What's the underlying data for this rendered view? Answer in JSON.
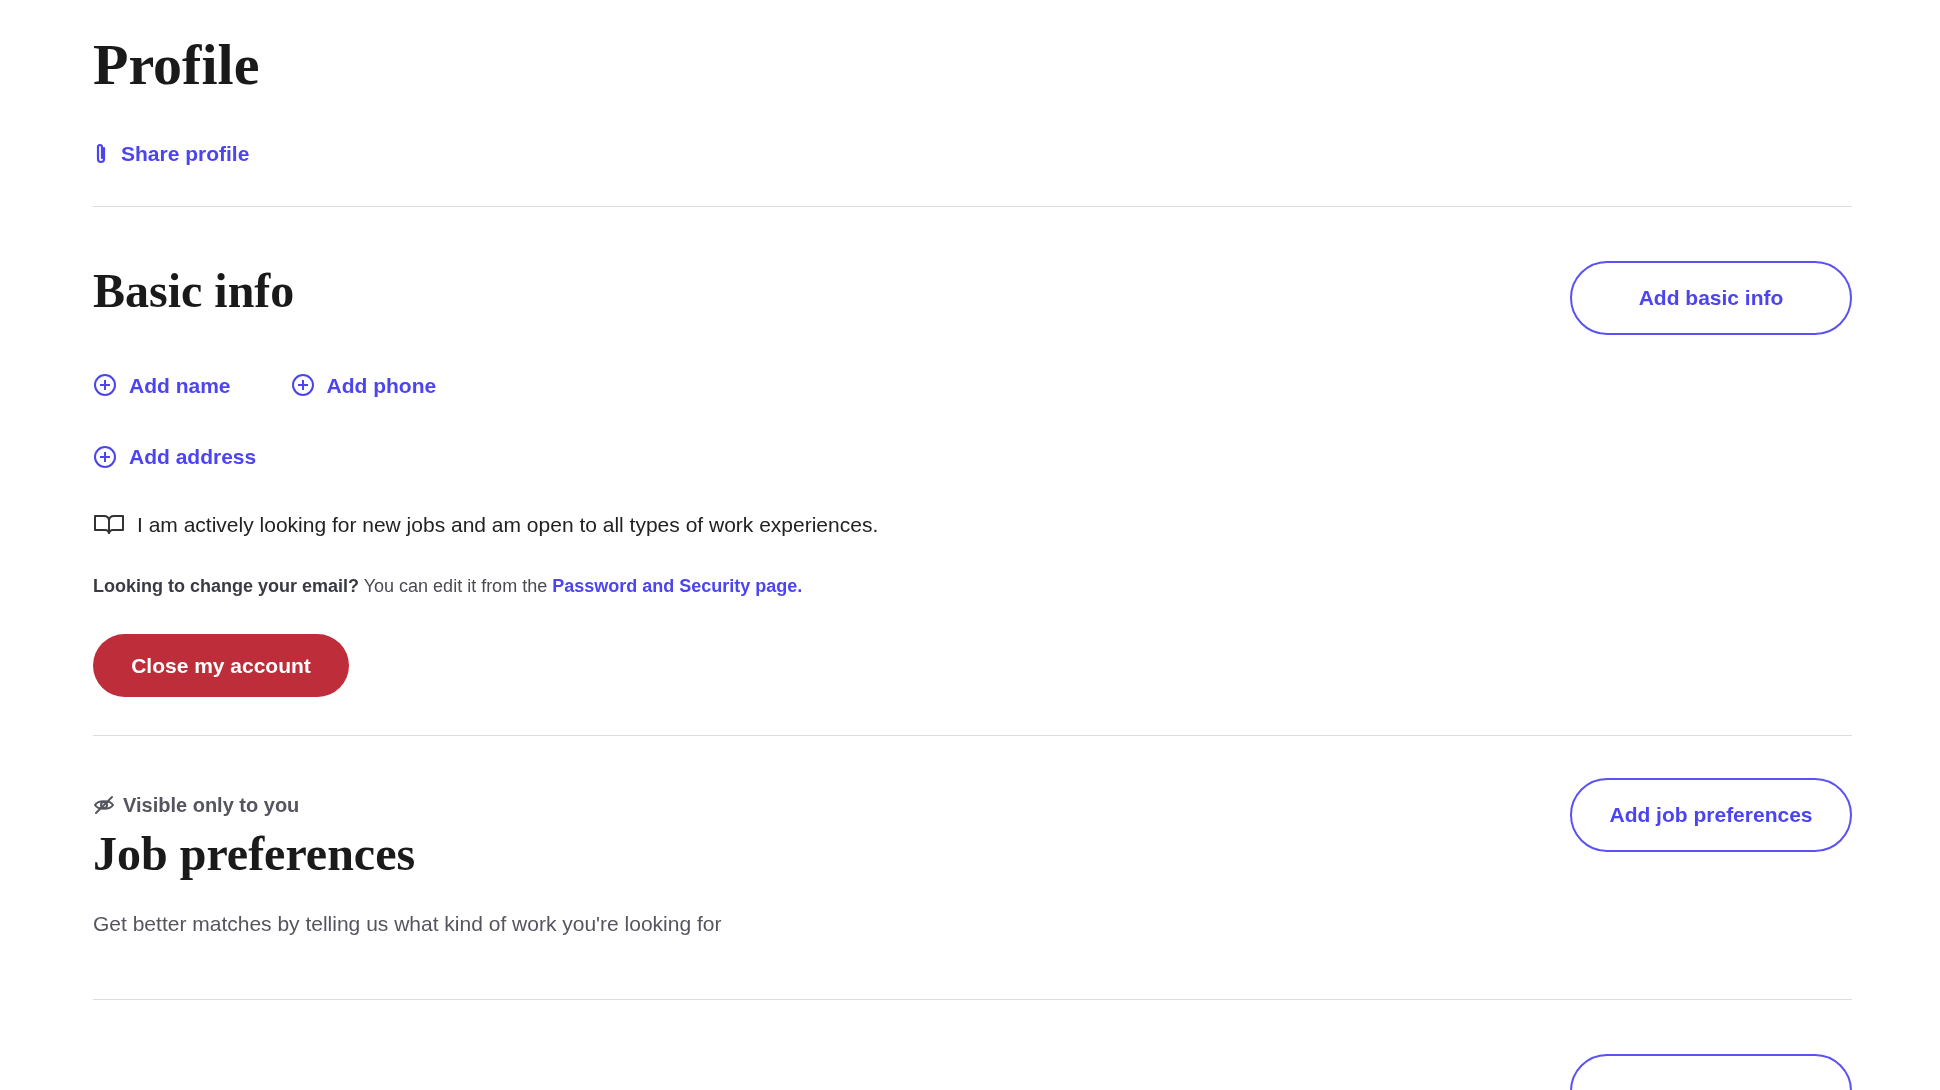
{
  "title": "Profile",
  "share_link": "Share profile",
  "basic_info": {
    "heading": "Basic info",
    "button": "Add basic info",
    "add_links": [
      {
        "label": "Add name"
      },
      {
        "label": "Add phone"
      },
      {
        "label": "Add address"
      }
    ],
    "statement": "I am actively looking for new jobs and am open to all types of work experiences.",
    "email_note": "**Looking to change your email?** You can edit it from the ",
    "email_link": "Password and Security page.",
    "close_button": "Close my account"
  },
  "job_preferences": {
    "visibility": "Visible only to you",
    "heading": "Job preferences",
    "description": "Get better matches by telling us what kind of work you're looking for",
    "button": "Add job preferences"
  }
}
